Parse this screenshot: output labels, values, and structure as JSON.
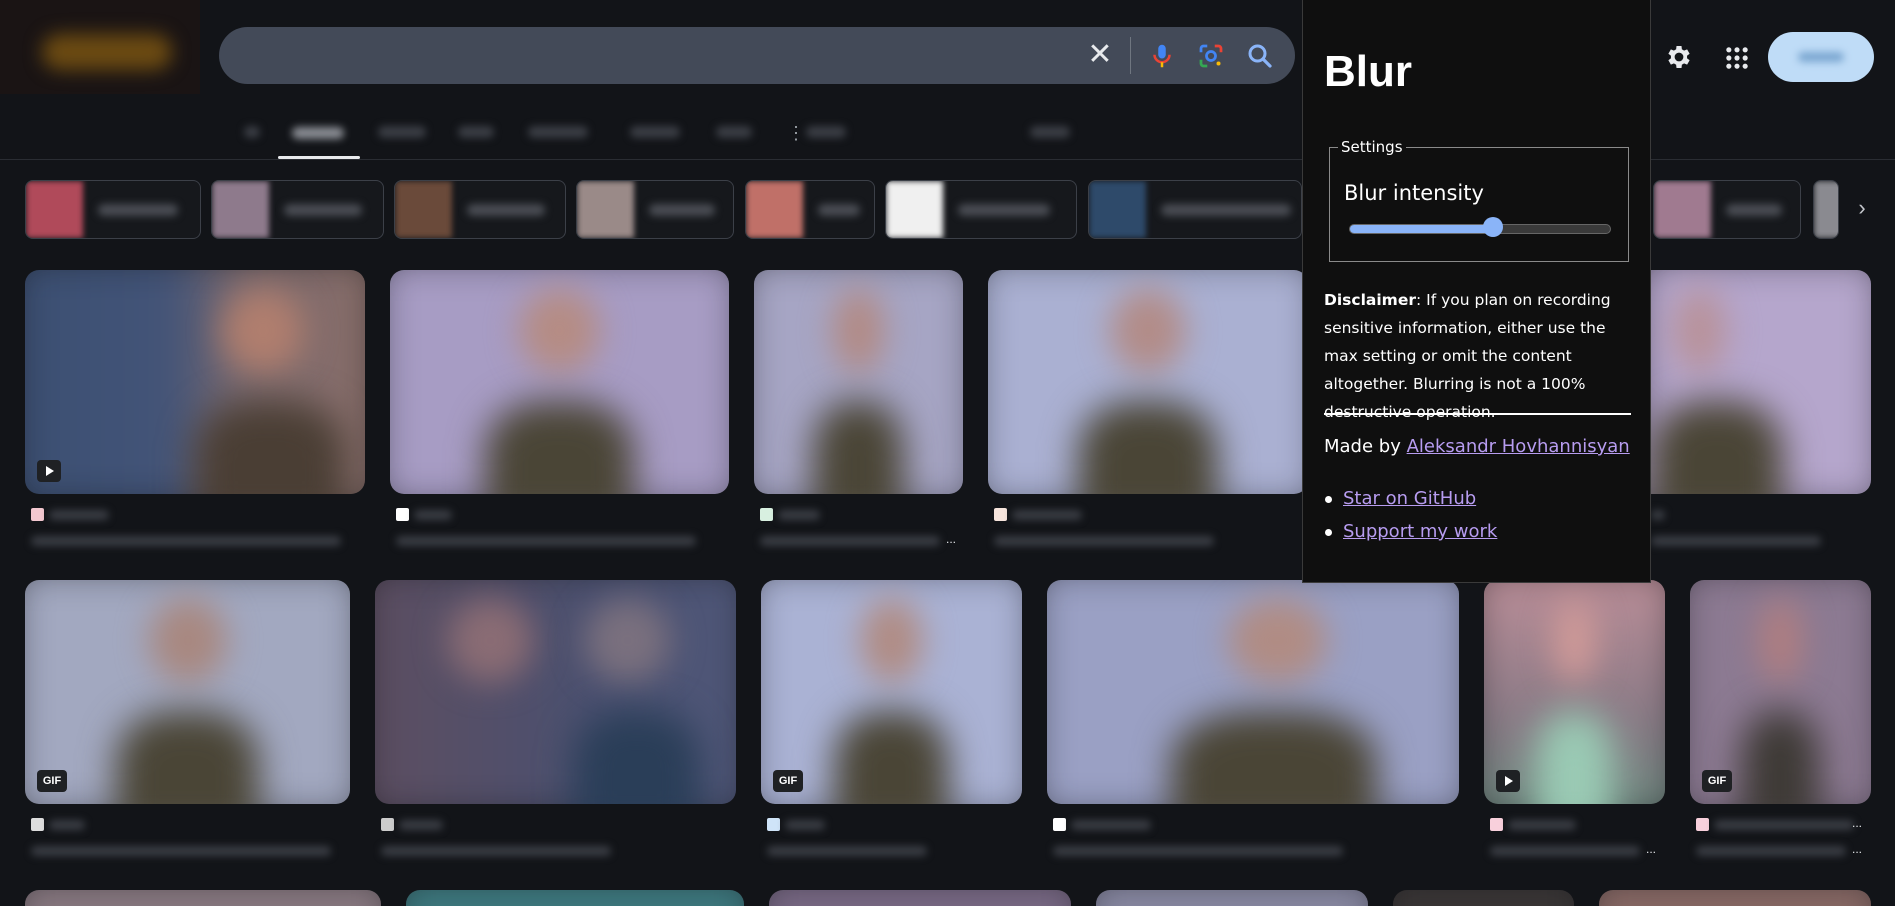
{
  "popup": {
    "title": "Blur",
    "settings_legend": "Settings",
    "intensity_label": "Blur intensity",
    "intensity_value": 0.55,
    "disclaimer_label": "Disclaimer",
    "disclaimer_text": ": If you plan on recording sensitive information, either use the max setting or omit the content altogether. Blurring is not a 100% destructive operation.",
    "made_by_prefix": "Made by ",
    "author": "Aleksandr Hovhannisyan",
    "links": [
      "Star on GitHub",
      "Support my work"
    ]
  },
  "badges": {
    "gif": "GIF"
  },
  "ellipsis": "...",
  "colors": {
    "accent": "#8ab4f8",
    "link": "#b79cf0",
    "background": "#121418",
    "search_bg": "#434a58",
    "signin_bg": "#bfdcf7"
  },
  "icons": [
    "close-icon",
    "microphone-icon",
    "lens-icon",
    "search-icon",
    "gear-icon",
    "apps-icon",
    "chevron-right-icon",
    "more-vert-icon",
    "play-icon"
  ]
}
